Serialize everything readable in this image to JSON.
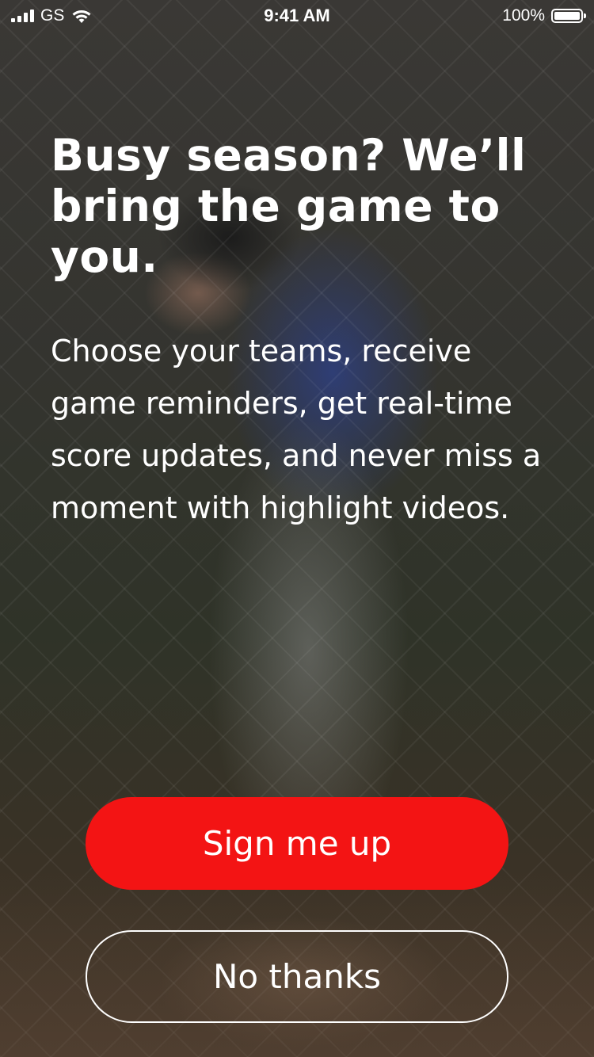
{
  "status_bar": {
    "carrier": "GS",
    "time": "9:41 AM",
    "battery_percent": "100%",
    "battery_level": 1.0,
    "icons": [
      "signal-bars-icon",
      "wifi-icon",
      "battery-icon"
    ]
  },
  "onboarding": {
    "headline": "Busy season? We’ll bring the game to you.",
    "body": "Choose your teams, receive game reminders, get real-time score updates, and never miss a moment with highlight videos."
  },
  "actions": {
    "primary_label": "Sign me up",
    "secondary_label": "No thanks"
  },
  "colors": {
    "primary_button": "#f31414",
    "text": "#ffffff",
    "overlay": "#1f1d1c"
  }
}
